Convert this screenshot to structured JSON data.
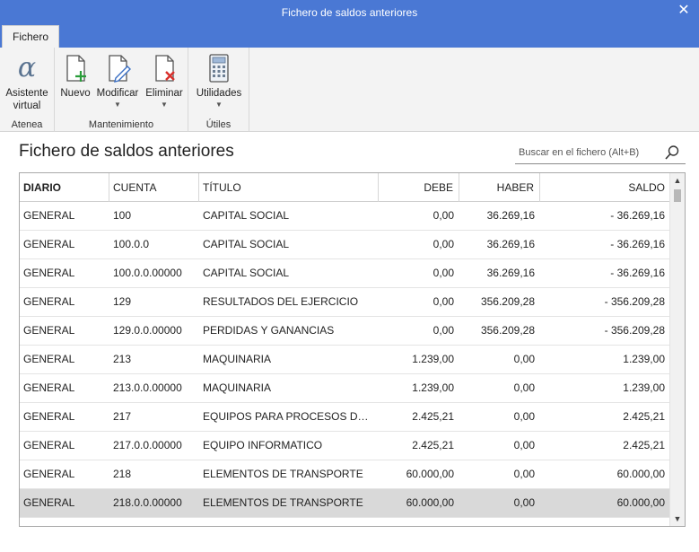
{
  "window": {
    "title": "Fichero de saldos anteriores"
  },
  "tabs": [
    {
      "label": "Fichero"
    }
  ],
  "ribbon": {
    "groups": {
      "atenea": {
        "label": "Atenea",
        "buttons": {
          "asistente": {
            "line1": "Asistente",
            "line2": "virtual",
            "icon": "alpha-icon"
          }
        }
      },
      "mantenimiento": {
        "label": "Mantenimiento",
        "buttons": {
          "nuevo": {
            "label": "Nuevo",
            "icon": "new-document-icon"
          },
          "modificar": {
            "label": "Modificar",
            "icon": "edit-document-icon"
          },
          "eliminar": {
            "label": "Eliminar",
            "icon": "delete-document-icon"
          }
        }
      },
      "utiles": {
        "label": "Útiles",
        "buttons": {
          "utilidades": {
            "label": "Utilidades",
            "icon": "calculator-icon"
          }
        }
      }
    }
  },
  "page": {
    "heading": "Fichero de saldos anteriores"
  },
  "search": {
    "placeholder": "Buscar en el fichero (Alt+B)",
    "value": ""
  },
  "table": {
    "headers": [
      "DIARIO",
      "CUENTA",
      "TÍTULO",
      "DEBE",
      "HABER",
      "SALDO"
    ],
    "rows": [
      [
        "GENERAL",
        "100",
        "CAPITAL SOCIAL",
        "0,00",
        "36.269,16",
        "- 36.269,16"
      ],
      [
        "GENERAL",
        "100.0.0",
        "CAPITAL SOCIAL",
        "0,00",
        "36.269,16",
        "- 36.269,16"
      ],
      [
        "GENERAL",
        "100.0.0.00000",
        "CAPITAL SOCIAL",
        "0,00",
        "36.269,16",
        "- 36.269,16"
      ],
      [
        "GENERAL",
        "129",
        "RESULTADOS DEL EJERCICIO",
        "0,00",
        "356.209,28",
        "- 356.209,28"
      ],
      [
        "GENERAL",
        "129.0.0.00000",
        "PERDIDAS Y GANANCIAS",
        "0,00",
        "356.209,28",
        "- 356.209,28"
      ],
      [
        "GENERAL",
        "213",
        "MAQUINARIA",
        "1.239,00",
        "0,00",
        "1.239,00"
      ],
      [
        "GENERAL",
        "213.0.0.00000",
        "MAQUINARIA",
        "1.239,00",
        "0,00",
        "1.239,00"
      ],
      [
        "GENERAL",
        "217",
        "EQUIPOS PARA PROCESOS DE INF…",
        "2.425,21",
        "0,00",
        "2.425,21"
      ],
      [
        "GENERAL",
        "217.0.0.00000",
        "EQUIPO INFORMATICO",
        "2.425,21",
        "0,00",
        "2.425,21"
      ],
      [
        "GENERAL",
        "218",
        "ELEMENTOS DE TRANSPORTE",
        "60.000,00",
        "0,00",
        "60.000,00"
      ],
      [
        "GENERAL",
        "218.0.0.00000",
        "ELEMENTOS DE TRANSPORTE",
        "60.000,00",
        "0,00",
        "60.000,00"
      ]
    ],
    "selected_row": 10
  },
  "colors": {
    "titlebar": "#4a78d4",
    "ribbon_bg": "#f3f3f3",
    "selected_row": "#d9d9d9",
    "delete_red": "#d9302c",
    "add_green": "#2a9d3a"
  }
}
